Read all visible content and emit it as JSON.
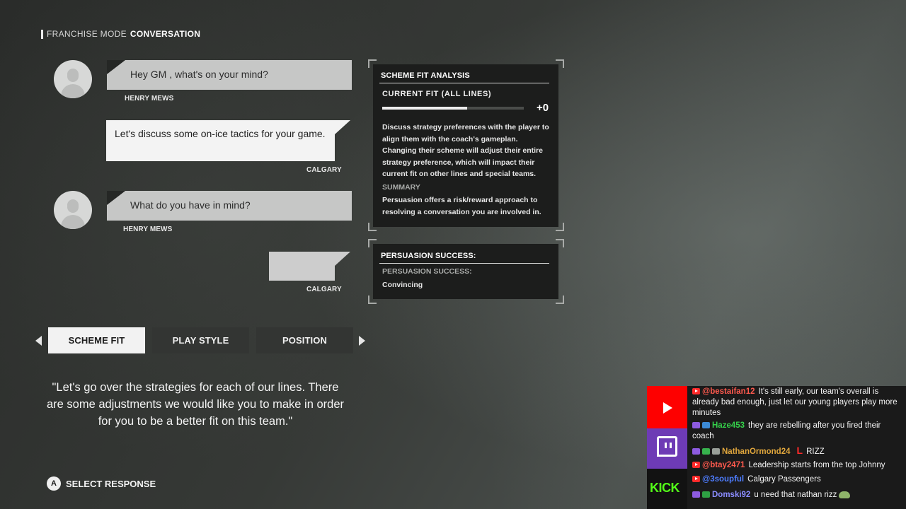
{
  "header": {
    "mode": "FRANCHISE MODE",
    "title": "CONVERSATION"
  },
  "conversation": [
    {
      "speaker": "HENRY MEWS",
      "side": "left",
      "text": "Hey GM , what's on your mind?"
    },
    {
      "speaker": "CALGARY",
      "side": "right",
      "text": "Let's discuss some on-ice tactics for your game."
    },
    {
      "speaker": "HENRY MEWS",
      "side": "left",
      "text": "What do you have in mind?"
    },
    {
      "speaker": "CALGARY",
      "side": "right",
      "text": ""
    }
  ],
  "analysis": {
    "title": "SCHEME FIT ANALYSIS",
    "current_fit_label": "CURRENT FIT (ALL LINES)",
    "current_fit_level": 0.6,
    "current_fit_value": "+0",
    "description": "Discuss strategy preferences with the player to align them with the coach's gameplan. Changing their scheme will adjust their entire strategy preference, which will impact their current fit on other lines and special teams.",
    "summary_label": "SUMMARY",
    "summary_text": "Persuasion offers a risk/reward approach to resolving a conversation you are involved in."
  },
  "persuasion": {
    "title": "PERSUASION SUCCESS:",
    "label": "PERSUASION SUCCESS:",
    "value": "Convincing"
  },
  "tabs": [
    {
      "label": "SCHEME FIT",
      "active": true
    },
    {
      "label": "PLAY STYLE",
      "active": false
    },
    {
      "label": "POSITION",
      "active": false
    }
  ],
  "response_quote": "\"Let's go over the strategies for each of our lines. There are some adjustments we would like you to make in order for you to be a better fit on this team.\"",
  "prompt": {
    "button": "A",
    "label": "SELECT RESPONSE"
  },
  "stream_chat": {
    "platform_icons": [
      "youtube-icon",
      "twitch-icon",
      "kick-logo"
    ],
    "kick_label": "KICK",
    "messages": [
      {
        "platform": "youtube",
        "user": "@bestaifan12",
        "user_color": "#ff5a4e",
        "text": "It's still early, our team's overall is already bad enough, just let our young players play more minutes"
      },
      {
        "platform": "twitch",
        "user": "Haze453",
        "user_color": "#35d04a",
        "text": "they are rebelling after you fired their coach"
      },
      {
        "platform": "twitch",
        "user": "NathanOrmond24",
        "user_color": "#e0a63c",
        "emote": "L",
        "text": "RIZZ"
      },
      {
        "platform": "youtube",
        "user": "@btay2471",
        "user_color": "#ff5a4e",
        "text": "Leadership starts from the top Johnny"
      },
      {
        "platform": "youtube",
        "user": "@3soupful",
        "user_color": "#4e7dff",
        "text": "Calgary Passengers"
      },
      {
        "platform": "twitch",
        "user": "Domski92",
        "user_color": "#8b8cff",
        "text": "u need that nathan rizz"
      }
    ]
  }
}
